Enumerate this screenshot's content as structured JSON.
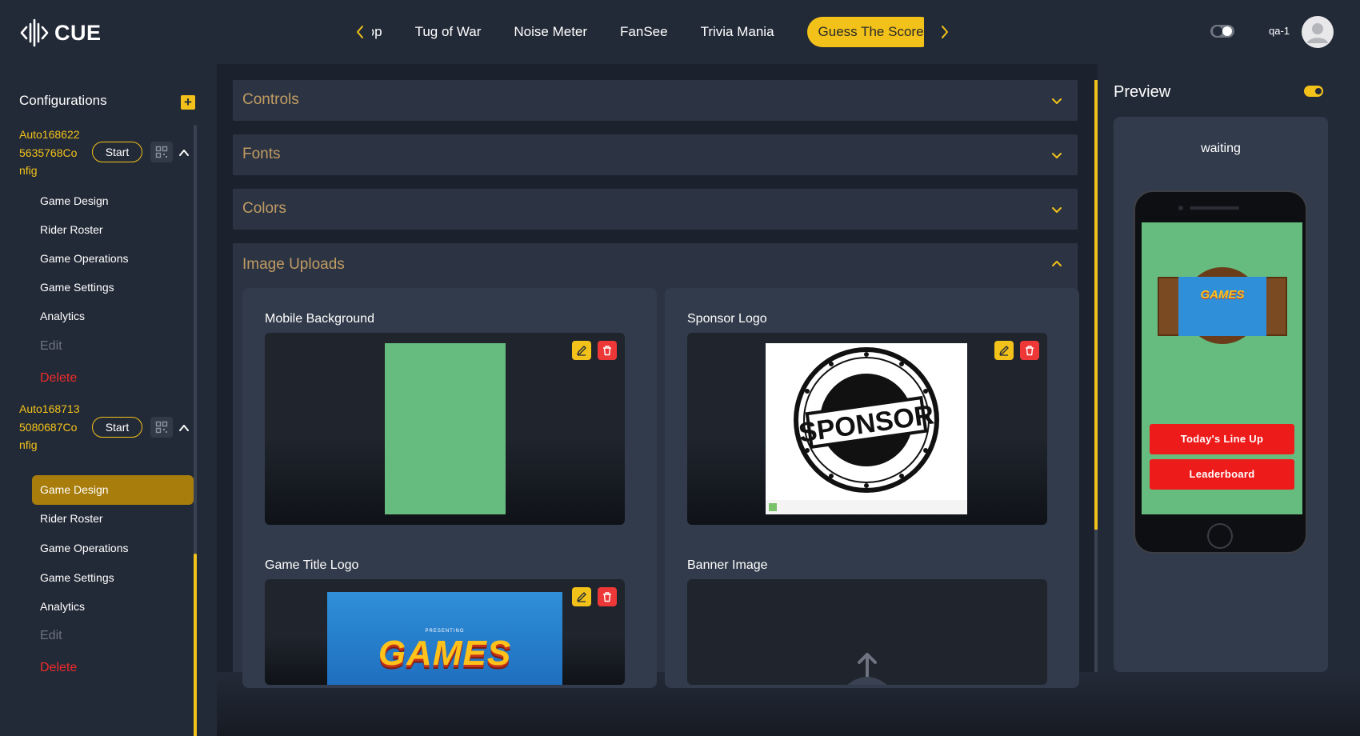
{
  "app": {
    "logo_text": "CUE",
    "user_name": "qa-1"
  },
  "nav": {
    "tabs": [
      "rop",
      "Tug of War",
      "Noise Meter",
      "FanSee",
      "Trivia Mania",
      "Guess The Score"
    ],
    "active_tab": "Guess The Score"
  },
  "sidebar": {
    "heading": "Configurations",
    "configs": [
      {
        "name_lines": [
          "Auto168622",
          "5635768Co",
          "nfig"
        ],
        "start_label": "Start",
        "expanded": true,
        "items": [
          "Game Design",
          "Rider Roster",
          "Game Operations",
          "Game Settings",
          "Analytics"
        ],
        "edit_label": "Edit",
        "delete_label": "Delete"
      },
      {
        "name_lines": [
          "Auto168713",
          "5080687Co",
          "nfig"
        ],
        "start_label": "Start",
        "expanded": true,
        "active_item": "Game Design",
        "items": [
          "Game Design",
          "Rider Roster",
          "Game Operations",
          "Game Settings",
          "Analytics"
        ],
        "edit_label": "Edit",
        "delete_label": "Delete"
      }
    ]
  },
  "main": {
    "sections": [
      "Controls",
      "Fonts",
      "Colors",
      "Image Uploads"
    ],
    "open_section": "Image Uploads",
    "uploads": [
      {
        "label": "Mobile Background",
        "image": "green-background"
      },
      {
        "label": "Sponsor Logo",
        "image": "sponsor-stamp",
        "image_text": "SPONSOR"
      },
      {
        "label": "Game Title Logo",
        "image": "games-title",
        "image_text": "GAMES",
        "image_subtext": "PRESENTING"
      },
      {
        "label": "Banner Image",
        "image": "empty-upload"
      }
    ]
  },
  "preview": {
    "title": "Preview",
    "status": "waiting",
    "phone_logo_text": "GAMES",
    "buttons": [
      "Today's Line Up",
      "Leaderboard"
    ]
  },
  "colors": {
    "accent": "#f2c21a",
    "background": "#232a37",
    "panel": "#2c3443",
    "danger": "#ee2b2b",
    "section_title": "#c09b62",
    "preview_green": "#66bb7f"
  }
}
